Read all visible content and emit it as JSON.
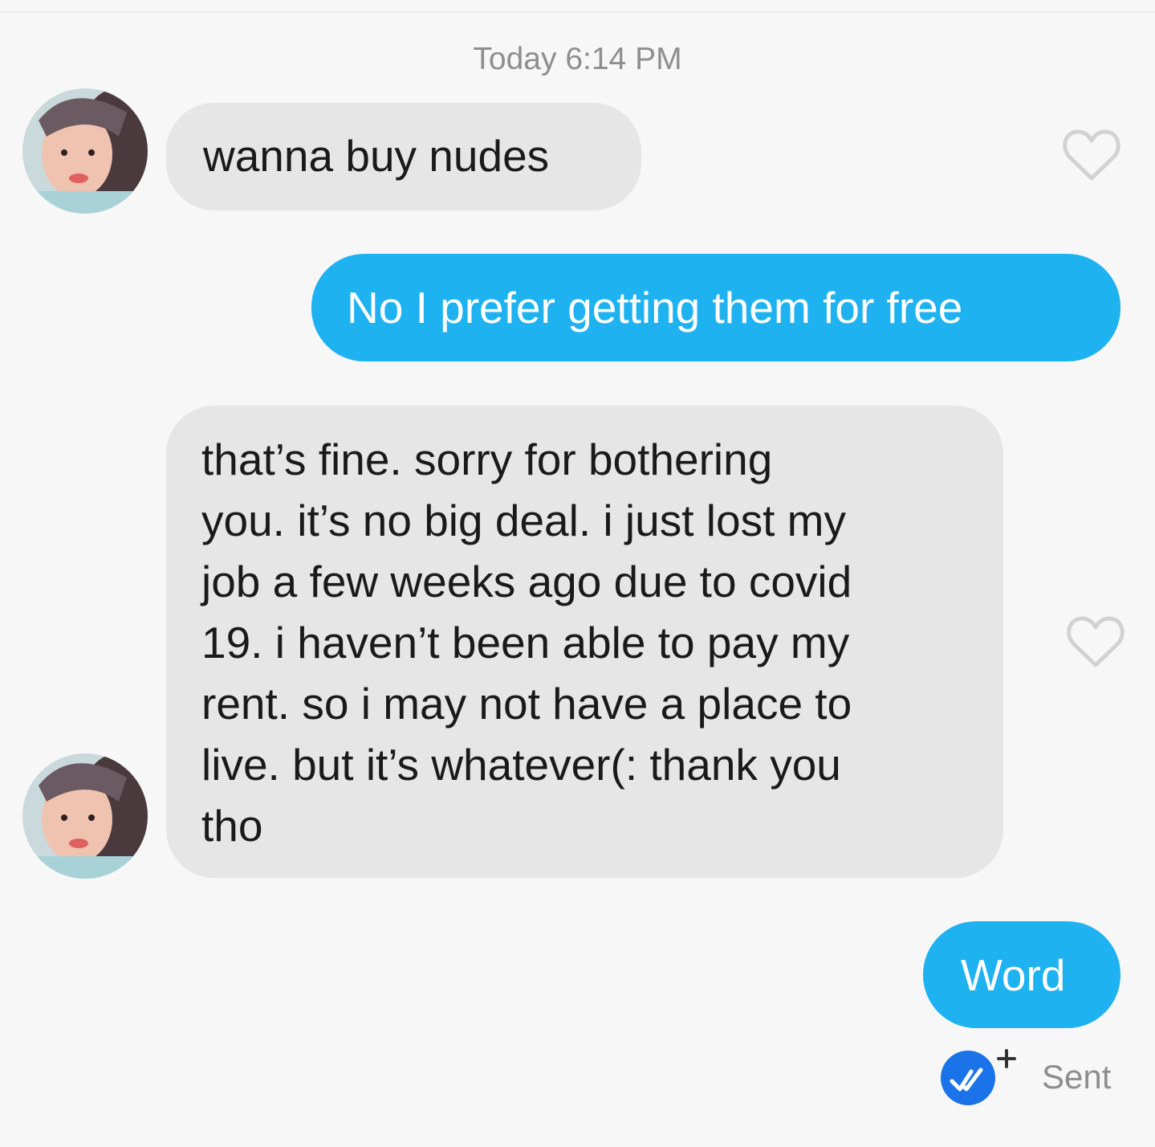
{
  "conversation": {
    "timestamp": "Today 6:14 PM",
    "messages": [
      {
        "direction": "incoming",
        "text": "wanna buy nudes",
        "liked": false
      },
      {
        "direction": "outgoing",
        "text": "No I prefer getting them for free"
      },
      {
        "direction": "incoming",
        "text_lines": [
          "that’s fine. sorry for bothering",
          "you. it’s no big deal. i just lost my",
          "job a few weeks ago due to covid",
          "19. i haven’t been able to pay my",
          "rent. so i may not have a place to",
          "live. but it’s whatever(: thank you",
          "tho"
        ],
        "liked": false
      },
      {
        "direction": "outgoing",
        "text": "Word"
      }
    ],
    "status": "Sent"
  },
  "icons": {
    "like": "heart-outline-icon",
    "receipt": "double-check-icon",
    "avatar": "contact-avatar"
  },
  "colors": {
    "outgoing_bubble": "#1fb2f0",
    "incoming_bubble": "#e6e6e6",
    "meta_text": "#8e8e8e",
    "receipt_badge": "#1a73e8"
  }
}
